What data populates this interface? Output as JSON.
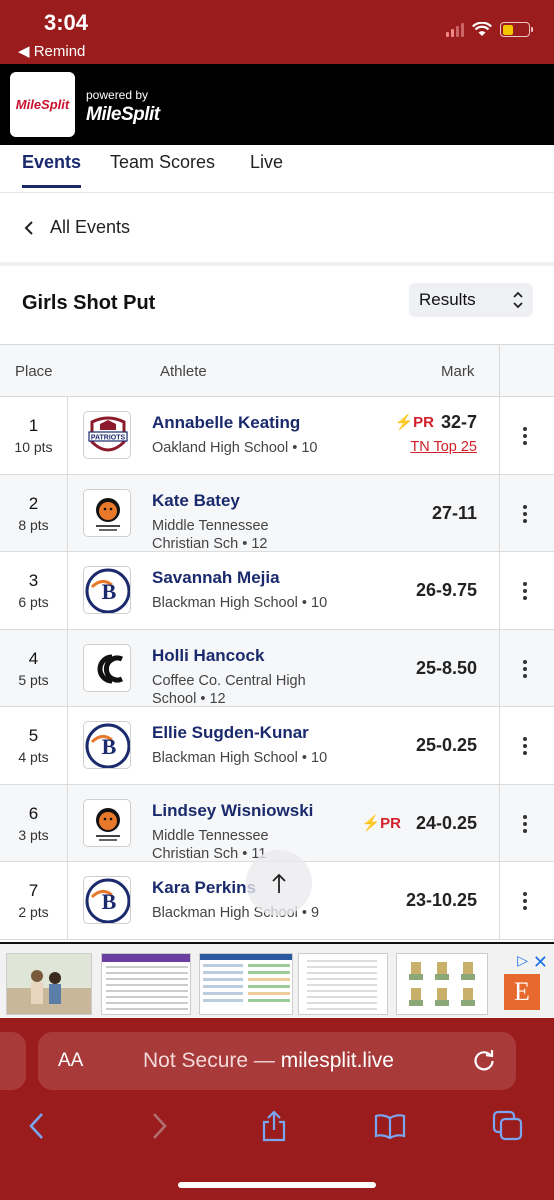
{
  "status_bar": {
    "time": "3:04",
    "back_app": "◀ Remind"
  },
  "header": {
    "logo_text": "MileSplit",
    "powered_by": "powered by",
    "brand": "MileSplit"
  },
  "tabs": [
    {
      "label": "Events",
      "active": true
    },
    {
      "label": "Team Scores",
      "active": false
    },
    {
      "label": "Live",
      "active": false
    }
  ],
  "nav": {
    "back_label": "All Events"
  },
  "event": {
    "title": "Girls Shot Put",
    "view_select": "Results"
  },
  "table": {
    "headers": {
      "place": "Place",
      "athlete": "Athlete",
      "mark": "Mark"
    },
    "rows": [
      {
        "place": "1",
        "pts": "10 pts",
        "name": "Annabelle Keating",
        "school": "Oakland High School • 10",
        "mark": "32-7",
        "pr": "PR",
        "badge": "TN Top 25",
        "logo": "patriots-logo"
      },
      {
        "place": "2",
        "pts": "8 pts",
        "name": "Kate Batey",
        "school": "Middle Tennessee Christian Sch • 12",
        "mark": "27-11",
        "pr": "",
        "badge": "",
        "logo": "cross-country-logo"
      },
      {
        "place": "3",
        "pts": "6 pts",
        "name": "Savannah Mejia",
        "school": "Blackman High School • 10",
        "mark": "26-9.75",
        "pr": "",
        "badge": "",
        "logo": "blackman-logo"
      },
      {
        "place": "4",
        "pts": "5 pts",
        "name": "Holli Hancock",
        "school": "Coffee Co. Central High School • 12",
        "mark": "25-8.50",
        "pr": "",
        "badge": "",
        "logo": "cc-logo"
      },
      {
        "place": "5",
        "pts": "4 pts",
        "name": "Ellie Sugden-Kunar",
        "school": "Blackman High School • 10",
        "mark": "25-0.25",
        "pr": "",
        "badge": "",
        "logo": "blackman-logo"
      },
      {
        "place": "6",
        "pts": "3 pts",
        "name": "Lindsey Wisniowski",
        "school": "Middle Tennessee Christian Sch • 11",
        "mark": "24-0.25",
        "pr": "PR",
        "badge": "",
        "logo": "cross-country-logo"
      },
      {
        "place": "7",
        "pts": "2 pts",
        "name": "Kara Perkins",
        "school": "Blackman High School • 9",
        "mark": "23-10.25",
        "pr": "",
        "badge": "",
        "logo": "blackman-logo"
      }
    ]
  },
  "ad": {
    "brand_letter": "E"
  },
  "safari": {
    "aa": "AA",
    "url_prefix": "Not Secure — ",
    "url_domain": "milesplit.live"
  },
  "colors": {
    "accent": "#1a2a6c",
    "pr_red": "#d21f2a",
    "chrome": "#9b1c1c"
  }
}
